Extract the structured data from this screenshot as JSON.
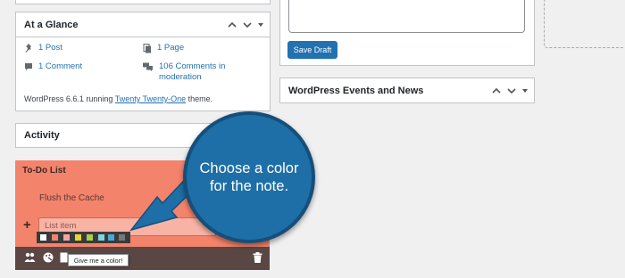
{
  "at_a_glance": {
    "title": "At a Glance",
    "posts": "1 Post",
    "pages": "1 Page",
    "comments": "1 Comment",
    "moderation_line1": "106 Comments in",
    "moderation_line2": "moderation",
    "version_prefix": "WordPress 6.6.1 running ",
    "theme_link": "Twenty Twenty-One",
    "version_suffix": " theme."
  },
  "activity": {
    "title": "Activity"
  },
  "draft": {
    "save_label": "Save Draft"
  },
  "events": {
    "title": "WordPress Events and News"
  },
  "todo": {
    "title": "To-Do List",
    "item": "Flush the Cache",
    "input_placeholder": "List item",
    "add_symbol": "+",
    "tooltip": "Give me a color!",
    "colors": [
      "#ffffff",
      "#f4836b",
      "#f5a4a4",
      "#e8d33a",
      "#a8d14c",
      "#7fd3de",
      "#4aa7d6",
      "#777777"
    ],
    "background_color": "#f4836b",
    "toolbar_color": "#5a4744"
  },
  "callout": {
    "line1": "Choose a color",
    "line2": "for the note.",
    "color": "#1e6fa7"
  }
}
